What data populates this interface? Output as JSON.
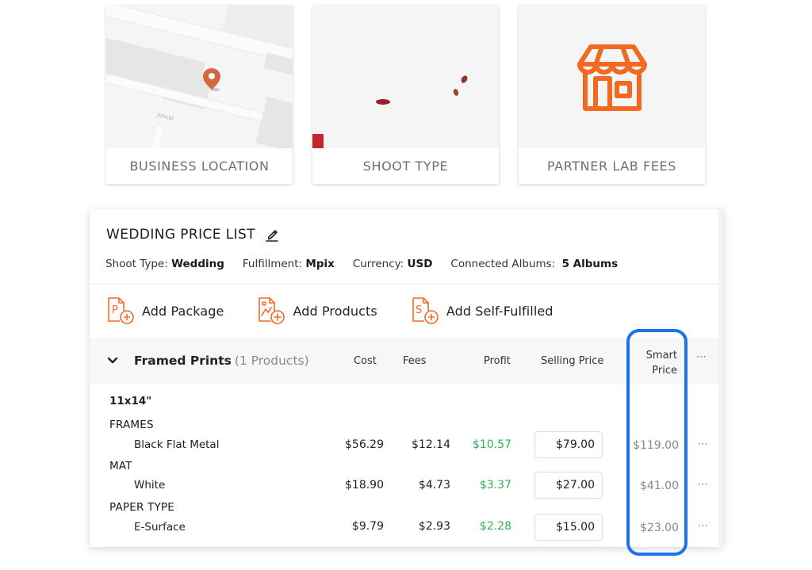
{
  "cards": [
    {
      "id": "location",
      "label": "BUSINESS LOCATION",
      "icon": "map-pin-icon",
      "street": "Juncal"
    },
    {
      "id": "shoot",
      "label": "SHOOT TYPE",
      "image": "bride-with-flower-crown-photo"
    },
    {
      "id": "lab",
      "label": "PARTNER LAB FEES",
      "icon": "storefront-icon"
    }
  ],
  "price_list": {
    "title": "WEDDING PRICE LIST",
    "edit_icon": "pencil-icon",
    "meta": [
      {
        "label": "Shoot Type:",
        "value": "Wedding"
      },
      {
        "label": "Fulfillment:",
        "value": "Mpix"
      },
      {
        "label": "Currency:",
        "value": "USD"
      },
      {
        "label": "Connected Albums:",
        "value": "5 Albums"
      }
    ],
    "actions": [
      {
        "label": "Add Package",
        "icon": "add-package-icon",
        "letter": "P"
      },
      {
        "label": "Add Products",
        "icon": "add-products-icon",
        "letter": ""
      },
      {
        "label": "Add Self-Fulfilled",
        "icon": "add-self-fulfilled-icon",
        "letter": "S"
      }
    ],
    "group": {
      "title": "Framed Prints",
      "count": "(1 Products)",
      "expanded": true,
      "columns": {
        "cost": "Cost",
        "fees": "Fees",
        "profit": "Profit",
        "selling_price": "Selling Price",
        "smart_price_line1": "Smart",
        "smart_price_line2": "Price",
        "more": "⋯"
      },
      "size": "11x14\"",
      "sections": [
        {
          "label": "FRAMES",
          "item": "Black Flat Metal",
          "cost": "$56.29",
          "fees": "$12.14",
          "profit": "$10.57",
          "selling_price": "$79.00",
          "smart_price": "$119.00"
        },
        {
          "label": "MAT",
          "item": "White",
          "cost": "$18.90",
          "fees": "$4.73",
          "profit": "$3.37",
          "selling_price": "$27.00",
          "smart_price": "$41.00"
        },
        {
          "label": "PAPER TYPE",
          "item": "E-Surface",
          "cost": "$9.79",
          "fees": "$2.93",
          "profit": "$2.28",
          "selling_price": "$15.00",
          "smart_price": "$23.00"
        }
      ],
      "row_more": "⋯"
    }
  },
  "colors": {
    "accent_orange": "#f26a21",
    "profit_green": "#2fae55",
    "highlight_blue": "#1a73e8",
    "pin_orange": "#d4673f"
  }
}
